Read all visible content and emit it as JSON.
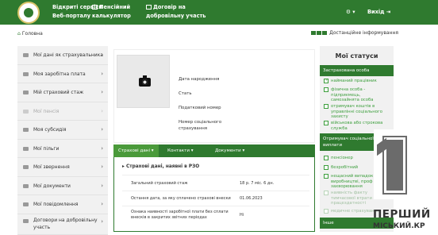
{
  "header": {
    "portal_title_line1": "Відкриті сервіси",
    "portal_title_line2": "Веб-порталу",
    "pension_calc_line1": "Пенсійний",
    "pension_calc_line2": "калькулятор",
    "contract_line1": "Договір на",
    "contract_line2": "добровільну участь",
    "settings_caret": "▾",
    "exit_label": "Вихід"
  },
  "breadcrumb": {
    "home": "Головна"
  },
  "topbar": {
    "accessibility_label": "Достанційне інформування"
  },
  "sidebar": {
    "items": [
      {
        "label": "Мої дані як страхувальника",
        "icon": "id-card-icon",
        "disabled": false
      },
      {
        "label": "Моя заробітна плата",
        "icon": "wallet-icon",
        "disabled": false
      },
      {
        "label": "Мій страховий стаж",
        "icon": "briefcase-icon",
        "disabled": false
      },
      {
        "label": "Мої пенсія",
        "icon": "pension-icon",
        "disabled": true
      },
      {
        "label": "Моя субсидія",
        "icon": "subsidy-icon",
        "disabled": false
      },
      {
        "label": "Мої пільги",
        "icon": "benefits-icon",
        "disabled": false
      },
      {
        "label": "Мої звернення",
        "icon": "envelope-icon",
        "disabled": false
      },
      {
        "label": "Мої документи",
        "icon": "document-icon",
        "disabled": false
      },
      {
        "label": "Мої повідомлення",
        "icon": "message-icon",
        "disabled": false
      },
      {
        "label_line1": "Договори на добровільну",
        "label_line2": "участь",
        "icon": "contract-icon",
        "disabled": false
      }
    ],
    "chevron": "›"
  },
  "profile": {
    "birth_date_label": "Дата народження",
    "sex_label": "Стать",
    "tax_number_label": "Податковий номер",
    "social_insurance_label_line1": "Номер соціального",
    "social_insurance_label_line2": "страхування"
  },
  "tabs": [
    {
      "label": "Страхові дані",
      "active": true
    },
    {
      "label": "Контакти",
      "active": false
    },
    {
      "label": "Документи",
      "active": false
    }
  ],
  "insurance_panel": {
    "title": "Страхові дані, наявні в РЗО",
    "rows": [
      {
        "label_line1": "Загальний страховий стаж",
        "label_line2": "",
        "value": "18 р. 7 міс. 6 дн."
      },
      {
        "label_line1": "Остання дата, за яку сплачено страхові внески",
        "label_line2": "",
        "value": "01.06.2023"
      },
      {
        "label_line1": "Ознака наявності заробітної плати без сплати",
        "label_line2": "внесків в закритих звітних періодах",
        "value": "Ні"
      }
    ]
  },
  "statuses": {
    "title": "Мої статуси",
    "group1_title": "Застрахована особа",
    "group1_items": [
      {
        "label": "найманий працівник",
        "active": true,
        "checked": true
      },
      {
        "label_lines": [
          "фізична особа -",
          "підприємець,",
          "самозайнята особа"
        ],
        "active": false
      },
      {
        "label_lines": [
          "отримувач коштів в",
          "управлінні соціального",
          "захисту"
        ],
        "active": false
      },
      {
        "label_lines": [
          "військова або строкова",
          "служба"
        ],
        "active": false
      }
    ],
    "group2_title_line1": "Отримувач соціальної",
    "group2_title_line2": "виплати",
    "group2_items": [
      {
        "label": "пенсіонер",
        "active": false
      },
      {
        "label": "безробітний",
        "active": false
      },
      {
        "label_lines": [
          "нещасний випадок на",
          "виробництві, проф",
          "захворювання"
        ],
        "active": false
      },
      {
        "label_lines": [
          "наявність факту",
          "тимчасової втрати",
          "працездатності"
        ],
        "active": false
      },
      {
        "label": "медичне страхування",
        "active": false
      }
    ],
    "group3_title": "Інше"
  },
  "watermark": {
    "digit": "1",
    "line1": "ПЕРШИЙ",
    "line2": "МІСЬКИЙ.КР"
  },
  "colors": {
    "primary_green": "#2f7a2f",
    "light_green": "#3c9e3c",
    "sidebar_bg": "#f1f1f1"
  }
}
